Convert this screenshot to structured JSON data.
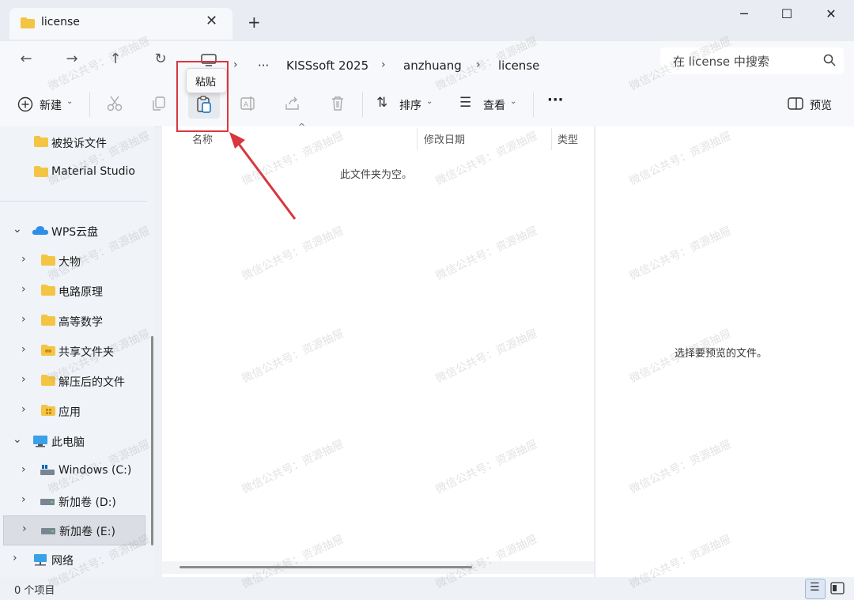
{
  "tab": {
    "title": "license",
    "close": "✕",
    "new": "+"
  },
  "window": {
    "minimize": "─",
    "maximize": "☐",
    "close": "✕"
  },
  "nav": {
    "back": "←",
    "forward": "→",
    "up": "↑",
    "refresh": "↻",
    "more": "···"
  },
  "breadcrumbs": [
    "KISSsoft 2025",
    "anzhuang",
    "license"
  ],
  "search": {
    "placeholder": "在 license 中搜索"
  },
  "toolbar": {
    "new_label": "新建",
    "sort_label": "排序",
    "view_label": "查看",
    "more": "···",
    "preview_label": "预览",
    "paste_tooltip": "粘贴"
  },
  "sidebar": {
    "items": [
      {
        "label": "被投诉文件",
        "icon": "folder-icon"
      },
      {
        "label": "Material Studio",
        "icon": "folder-icon"
      },
      {
        "label": "WPS云盘",
        "icon": "cloud-icon"
      },
      {
        "label": "大物",
        "icon": "folder-icon"
      },
      {
        "label": "电路原理",
        "icon": "folder-icon"
      },
      {
        "label": "高等数学",
        "icon": "folder-icon"
      },
      {
        "label": "共享文件夹",
        "icon": "shared-folder-icon"
      },
      {
        "label": "解压后的文件",
        "icon": "folder-icon"
      },
      {
        "label": "应用",
        "icon": "app-folder-icon"
      },
      {
        "label": "此电脑",
        "icon": "computer-icon"
      },
      {
        "label": "Windows (C:)",
        "icon": "drive-icon"
      },
      {
        "label": "新加卷 (D:)",
        "icon": "drive-icon"
      },
      {
        "label": "新加卷 (E:)",
        "icon": "drive-icon"
      },
      {
        "label": "网络",
        "icon": "network-icon"
      }
    ]
  },
  "columns": [
    "名称",
    "修改日期",
    "类型"
  ],
  "empty_message": "此文件夹为空。",
  "preview_message": "选择要预览的文件。",
  "status": {
    "count": "0 个项目"
  },
  "watermark": "微信公共号：资源抽屉",
  "colors": {
    "accent": "#0067c0",
    "annotation": "#d9363e",
    "folder": "#f4c542"
  }
}
